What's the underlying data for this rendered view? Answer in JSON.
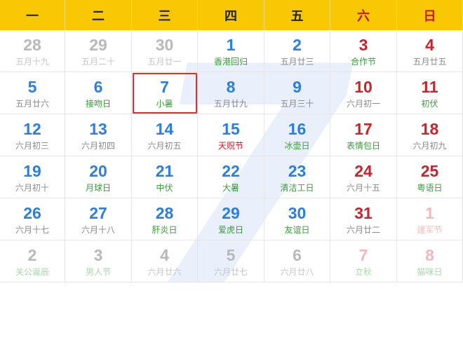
{
  "month_watermark": "7",
  "weekdays": [
    "一",
    "二",
    "三",
    "四",
    "五",
    "六",
    "日"
  ],
  "weeks": [
    [
      {
        "day": "28",
        "sub": "五月十九",
        "num_color": "gray",
        "sub_color": "lightgray"
      },
      {
        "day": "29",
        "sub": "五月二十",
        "num_color": "gray",
        "sub_color": "lightgray"
      },
      {
        "day": "30",
        "sub": "五月廿一",
        "num_color": "gray",
        "sub_color": "lightgray"
      },
      {
        "day": "1",
        "sub": "香港回归",
        "num_color": "blue",
        "sub_color": "green"
      },
      {
        "day": "2",
        "sub": "五月廿三",
        "num_color": "blue",
        "sub_color": "gray"
      },
      {
        "day": "3",
        "sub": "合作节",
        "num_color": "red",
        "sub_color": "green"
      },
      {
        "day": "4",
        "sub": "五月廿五",
        "num_color": "red",
        "sub_color": "gray"
      }
    ],
    [
      {
        "day": "5",
        "sub": "五月廿六",
        "num_color": "blue",
        "sub_color": "gray"
      },
      {
        "day": "6",
        "sub": "接吻日",
        "num_color": "blue",
        "sub_color": "green"
      },
      {
        "day": "7",
        "sub": "小暑",
        "num_color": "blue",
        "sub_color": "green",
        "selected": true
      },
      {
        "day": "8",
        "sub": "五月廿九",
        "num_color": "blue",
        "sub_color": "gray"
      },
      {
        "day": "9",
        "sub": "五月三十",
        "num_color": "blue",
        "sub_color": "gray"
      },
      {
        "day": "10",
        "sub": "六月初一",
        "num_color": "red",
        "sub_color": "gray"
      },
      {
        "day": "11",
        "sub": "初伏",
        "num_color": "red",
        "sub_color": "green"
      }
    ],
    [
      {
        "day": "12",
        "sub": "六月初三",
        "num_color": "blue",
        "sub_color": "gray"
      },
      {
        "day": "13",
        "sub": "六月初四",
        "num_color": "blue",
        "sub_color": "gray"
      },
      {
        "day": "14",
        "sub": "六月初五",
        "num_color": "blue",
        "sub_color": "gray"
      },
      {
        "day": "15",
        "sub": "天贶节",
        "num_color": "blue",
        "sub_color": "red"
      },
      {
        "day": "16",
        "sub": "冰壶日",
        "num_color": "blue",
        "sub_color": "green"
      },
      {
        "day": "17",
        "sub": "表情包日",
        "num_color": "red",
        "sub_color": "green"
      },
      {
        "day": "18",
        "sub": "六月初九",
        "num_color": "red",
        "sub_color": "gray"
      }
    ],
    [
      {
        "day": "19",
        "sub": "六月初十",
        "num_color": "blue",
        "sub_color": "gray"
      },
      {
        "day": "20",
        "sub": "月球日",
        "num_color": "blue",
        "sub_color": "green"
      },
      {
        "day": "21",
        "sub": "中伏",
        "num_color": "blue",
        "sub_color": "green"
      },
      {
        "day": "22",
        "sub": "大暑",
        "num_color": "blue",
        "sub_color": "green"
      },
      {
        "day": "23",
        "sub": "清洁工日",
        "num_color": "blue",
        "sub_color": "green"
      },
      {
        "day": "24",
        "sub": "六月十五",
        "num_color": "red",
        "sub_color": "gray"
      },
      {
        "day": "25",
        "sub": "粤语日",
        "num_color": "red",
        "sub_color": "green"
      }
    ],
    [
      {
        "day": "26",
        "sub": "六月十七",
        "num_color": "blue",
        "sub_color": "gray"
      },
      {
        "day": "27",
        "sub": "六月十八",
        "num_color": "blue",
        "sub_color": "gray"
      },
      {
        "day": "28",
        "sub": "肝炎日",
        "num_color": "blue",
        "sub_color": "green"
      },
      {
        "day": "29",
        "sub": "爱虎日",
        "num_color": "blue",
        "sub_color": "green"
      },
      {
        "day": "30",
        "sub": "友谊日",
        "num_color": "blue",
        "sub_color": "green"
      },
      {
        "day": "31",
        "sub": "六月廿二",
        "num_color": "red",
        "sub_color": "gray"
      },
      {
        "day": "1",
        "sub": "建军节",
        "num_color": "pink",
        "sub_color": "lightpink"
      }
    ],
    [
      {
        "day": "2",
        "sub": "关公诞辰",
        "num_color": "gray",
        "sub_color": "lightgreen"
      },
      {
        "day": "3",
        "sub": "男人节",
        "num_color": "gray",
        "sub_color": "lightgreen"
      },
      {
        "day": "4",
        "sub": "六月廿六",
        "num_color": "gray",
        "sub_color": "lightgray"
      },
      {
        "day": "5",
        "sub": "六月廿七",
        "num_color": "gray",
        "sub_color": "lightgray"
      },
      {
        "day": "6",
        "sub": "六月廿八",
        "num_color": "gray",
        "sub_color": "lightgray"
      },
      {
        "day": "7",
        "sub": "立秋",
        "num_color": "pink",
        "sub_color": "lightgreen"
      },
      {
        "day": "8",
        "sub": "猫咪日",
        "num_color": "pink",
        "sub_color": "lightgreen"
      }
    ]
  ]
}
